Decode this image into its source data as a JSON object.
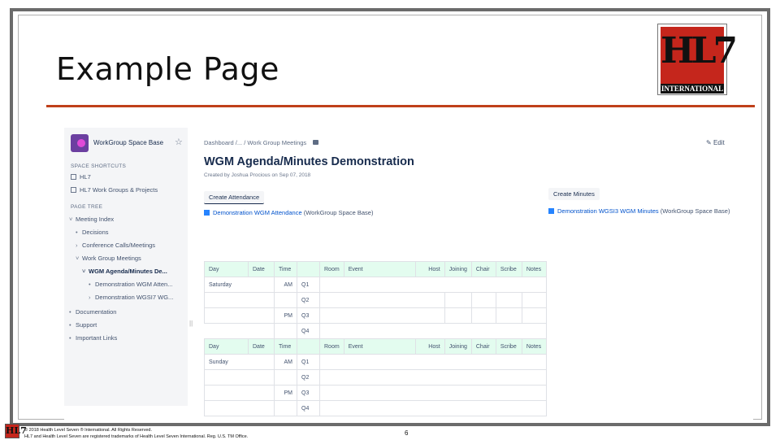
{
  "slide": {
    "title": "Example Page",
    "page_number": "6"
  },
  "logo": {
    "mark": "HL7",
    "subtitle": "INTERNATIONAL"
  },
  "footer": {
    "line1": "© 2018 Health Level Seven ® International. All Rights Reserved.",
    "line2": "HL7 and Health Level Seven are registered trademarks of Health Level Seven International. Reg. U.S. TM Office."
  },
  "sidebar": {
    "space_name": "WorkGroup Space Base",
    "shortcuts_heading": "SPACE SHORTCUTS",
    "shortcuts": [
      "HL7",
      "HL7 Work Groups & Projects"
    ],
    "tree_heading": "PAGE TREE",
    "tree": [
      {
        "label": "Meeting Index",
        "chev": "˅"
      },
      {
        "label": "Decisions",
        "chev": "•"
      },
      {
        "label": "Conference Calls/Meetings",
        "chev": "›"
      },
      {
        "label": "Work Group Meetings",
        "chev": "˅"
      },
      {
        "label": "WGM Agenda/Minutes De...",
        "chev": "˅"
      },
      {
        "label": "Demonstration WGM Atten...",
        "chev": "•"
      },
      {
        "label": "Demonstration WGSI7 WG...",
        "chev": "›"
      },
      {
        "label": "Documentation",
        "chev": "•"
      },
      {
        "label": "Support",
        "chev": "•"
      },
      {
        "label": "Important Links",
        "chev": "•"
      }
    ],
    "resize_glyph": "||"
  },
  "page": {
    "breadcrumb": "Dashboard  /...  /  Work Group Meetings",
    "edit_label": "Edit",
    "heading": "WGM Agenda/Minutes Demonstration",
    "created": "Created by Joshua Procious on Sep 07, 2018",
    "create_attendance": "Create Attendance",
    "create_minutes": "Create Minutes",
    "attendance_link": "Demonstration WGM Attendance",
    "attendance_tail": " (WorkGroup Space Base)",
    "minutes_link": "Demonstration WGSI3 WGM Minutes",
    "minutes_tail": " (WorkGroup Space Base)"
  },
  "table": {
    "headers": [
      "Day",
      "Date",
      "Time",
      "",
      "Room",
      "Event",
      "Host",
      "Joining",
      "Chair",
      "Scribe",
      "Notes"
    ],
    "saturday": {
      "day": "Saturday",
      "am": "AM",
      "pm": "PM",
      "quarters": [
        "Q1",
        "Q2",
        "Q3",
        "Q4"
      ]
    },
    "sunday": {
      "day": "Sunday",
      "am": "AM",
      "pm": "PM",
      "quarters": [
        "Q1",
        "Q2",
        "Q3",
        "Q4"
      ]
    }
  }
}
